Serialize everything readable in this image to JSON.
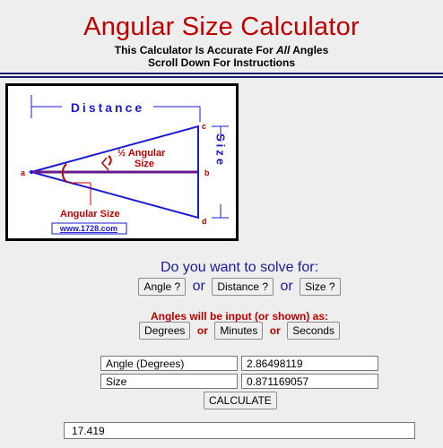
{
  "header": {
    "title": "Angular Size Calculator",
    "line1_before": "This Calculator Is Accurate For ",
    "line1_emph": "All",
    "line1_after": " Angles",
    "line2": "Scroll Down For Instructions"
  },
  "diagram": {
    "distance_label": "Distance",
    "half_angular_label": "½ Angular",
    "size_word": "Size",
    "angular_size_label": "Angular Size",
    "vertical_size_label": "Size",
    "point_a": "a",
    "point_b": "b",
    "point_c": "c",
    "point_d": "d",
    "watermark": "www.1728.com"
  },
  "solve": {
    "question": "Do you want to solve for:",
    "angle_btn": "Angle ?",
    "distance_btn": "Distance ?",
    "size_btn": "Size ?",
    "or": "or"
  },
  "units": {
    "note": "Angles will be input (or shown) as:",
    "degrees_btn": "Degrees",
    "minutes_btn": "Minutes",
    "seconds_btn": "Seconds",
    "or": "or"
  },
  "inputs": {
    "field1_label": "Angle (Degrees)",
    "field1_value": "2.86498119",
    "field2_label": "Size",
    "field2_value": "0.871169057",
    "calculate_btn": "CALCULATE"
  },
  "result": {
    "value": "17.419"
  }
}
